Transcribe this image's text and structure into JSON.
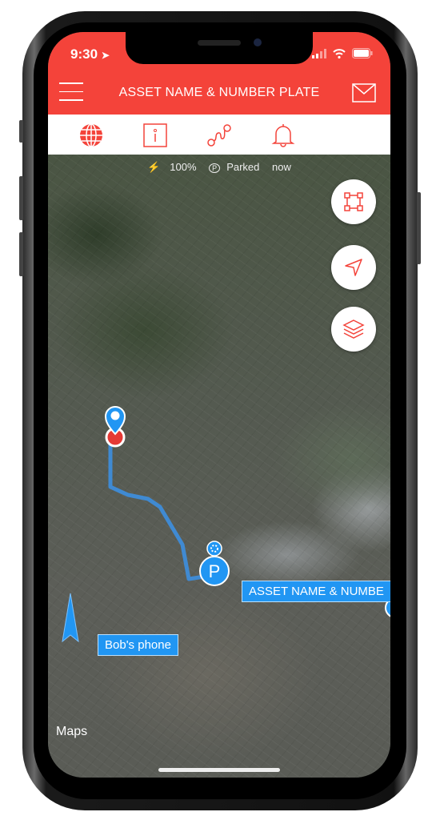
{
  "status_bar": {
    "time": "9:30"
  },
  "header": {
    "title": "ASSET NAME & NUMBER PLATE"
  },
  "tabs": [
    {
      "icon": "globe-icon",
      "active": true
    },
    {
      "icon": "info-icon"
    },
    {
      "icon": "route-icon"
    },
    {
      "icon": "bell-icon"
    }
  ],
  "info_bar": {
    "battery": "100%",
    "state": "Parked",
    "time": "now"
  },
  "map": {
    "labels": {
      "asset": "ASSET NAME & NUMBE",
      "phone": "Bob's phone"
    },
    "attribution": "Maps",
    "controls": [
      "fit-bounds-icon",
      "locate-icon",
      "layers-icon"
    ]
  },
  "colors": {
    "brand": "#f4433a",
    "marker": "#2196f3",
    "route": "#3d8fe0"
  }
}
